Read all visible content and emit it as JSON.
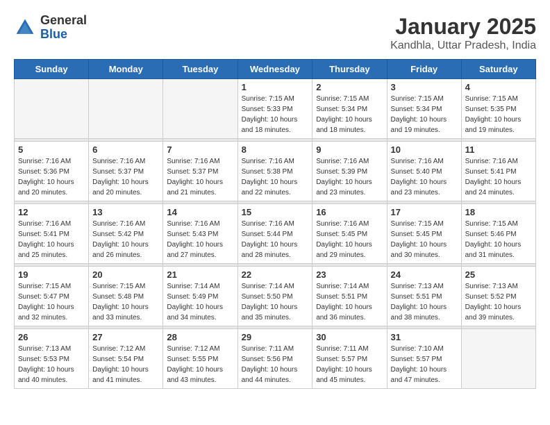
{
  "header": {
    "logo": {
      "brand1": "General",
      "brand2": "Blue"
    },
    "title": "January 2025",
    "subtitle": "Kandhla, Uttar Pradesh, India"
  },
  "weekdays": [
    "Sunday",
    "Monday",
    "Tuesday",
    "Wednesday",
    "Thursday",
    "Friday",
    "Saturday"
  ],
  "weeks": [
    [
      {
        "day": null,
        "sunrise": null,
        "sunset": null,
        "daylight": null
      },
      {
        "day": null,
        "sunrise": null,
        "sunset": null,
        "daylight": null
      },
      {
        "day": null,
        "sunrise": null,
        "sunset": null,
        "daylight": null
      },
      {
        "day": "1",
        "sunrise": "Sunrise: 7:15 AM",
        "sunset": "Sunset: 5:33 PM",
        "daylight": "Daylight: 10 hours and 18 minutes."
      },
      {
        "day": "2",
        "sunrise": "Sunrise: 7:15 AM",
        "sunset": "Sunset: 5:34 PM",
        "daylight": "Daylight: 10 hours and 18 minutes."
      },
      {
        "day": "3",
        "sunrise": "Sunrise: 7:15 AM",
        "sunset": "Sunset: 5:34 PM",
        "daylight": "Daylight: 10 hours and 19 minutes."
      },
      {
        "day": "4",
        "sunrise": "Sunrise: 7:15 AM",
        "sunset": "Sunset: 5:35 PM",
        "daylight": "Daylight: 10 hours and 19 minutes."
      }
    ],
    [
      {
        "day": "5",
        "sunrise": "Sunrise: 7:16 AM",
        "sunset": "Sunset: 5:36 PM",
        "daylight": "Daylight: 10 hours and 20 minutes."
      },
      {
        "day": "6",
        "sunrise": "Sunrise: 7:16 AM",
        "sunset": "Sunset: 5:37 PM",
        "daylight": "Daylight: 10 hours and 20 minutes."
      },
      {
        "day": "7",
        "sunrise": "Sunrise: 7:16 AM",
        "sunset": "Sunset: 5:37 PM",
        "daylight": "Daylight: 10 hours and 21 minutes."
      },
      {
        "day": "8",
        "sunrise": "Sunrise: 7:16 AM",
        "sunset": "Sunset: 5:38 PM",
        "daylight": "Daylight: 10 hours and 22 minutes."
      },
      {
        "day": "9",
        "sunrise": "Sunrise: 7:16 AM",
        "sunset": "Sunset: 5:39 PM",
        "daylight": "Daylight: 10 hours and 23 minutes."
      },
      {
        "day": "10",
        "sunrise": "Sunrise: 7:16 AM",
        "sunset": "Sunset: 5:40 PM",
        "daylight": "Daylight: 10 hours and 23 minutes."
      },
      {
        "day": "11",
        "sunrise": "Sunrise: 7:16 AM",
        "sunset": "Sunset: 5:41 PM",
        "daylight": "Daylight: 10 hours and 24 minutes."
      }
    ],
    [
      {
        "day": "12",
        "sunrise": "Sunrise: 7:16 AM",
        "sunset": "Sunset: 5:41 PM",
        "daylight": "Daylight: 10 hours and 25 minutes."
      },
      {
        "day": "13",
        "sunrise": "Sunrise: 7:16 AM",
        "sunset": "Sunset: 5:42 PM",
        "daylight": "Daylight: 10 hours and 26 minutes."
      },
      {
        "day": "14",
        "sunrise": "Sunrise: 7:16 AM",
        "sunset": "Sunset: 5:43 PM",
        "daylight": "Daylight: 10 hours and 27 minutes."
      },
      {
        "day": "15",
        "sunrise": "Sunrise: 7:16 AM",
        "sunset": "Sunset: 5:44 PM",
        "daylight": "Daylight: 10 hours and 28 minutes."
      },
      {
        "day": "16",
        "sunrise": "Sunrise: 7:16 AM",
        "sunset": "Sunset: 5:45 PM",
        "daylight": "Daylight: 10 hours and 29 minutes."
      },
      {
        "day": "17",
        "sunrise": "Sunrise: 7:15 AM",
        "sunset": "Sunset: 5:45 PM",
        "daylight": "Daylight: 10 hours and 30 minutes."
      },
      {
        "day": "18",
        "sunrise": "Sunrise: 7:15 AM",
        "sunset": "Sunset: 5:46 PM",
        "daylight": "Daylight: 10 hours and 31 minutes."
      }
    ],
    [
      {
        "day": "19",
        "sunrise": "Sunrise: 7:15 AM",
        "sunset": "Sunset: 5:47 PM",
        "daylight": "Daylight: 10 hours and 32 minutes."
      },
      {
        "day": "20",
        "sunrise": "Sunrise: 7:15 AM",
        "sunset": "Sunset: 5:48 PM",
        "daylight": "Daylight: 10 hours and 33 minutes."
      },
      {
        "day": "21",
        "sunrise": "Sunrise: 7:14 AM",
        "sunset": "Sunset: 5:49 PM",
        "daylight": "Daylight: 10 hours and 34 minutes."
      },
      {
        "day": "22",
        "sunrise": "Sunrise: 7:14 AM",
        "sunset": "Sunset: 5:50 PM",
        "daylight": "Daylight: 10 hours and 35 minutes."
      },
      {
        "day": "23",
        "sunrise": "Sunrise: 7:14 AM",
        "sunset": "Sunset: 5:51 PM",
        "daylight": "Daylight: 10 hours and 36 minutes."
      },
      {
        "day": "24",
        "sunrise": "Sunrise: 7:13 AM",
        "sunset": "Sunset: 5:51 PM",
        "daylight": "Daylight: 10 hours and 38 minutes."
      },
      {
        "day": "25",
        "sunrise": "Sunrise: 7:13 AM",
        "sunset": "Sunset: 5:52 PM",
        "daylight": "Daylight: 10 hours and 39 minutes."
      }
    ],
    [
      {
        "day": "26",
        "sunrise": "Sunrise: 7:13 AM",
        "sunset": "Sunset: 5:53 PM",
        "daylight": "Daylight: 10 hours and 40 minutes."
      },
      {
        "day": "27",
        "sunrise": "Sunrise: 7:12 AM",
        "sunset": "Sunset: 5:54 PM",
        "daylight": "Daylight: 10 hours and 41 minutes."
      },
      {
        "day": "28",
        "sunrise": "Sunrise: 7:12 AM",
        "sunset": "Sunset: 5:55 PM",
        "daylight": "Daylight: 10 hours and 43 minutes."
      },
      {
        "day": "29",
        "sunrise": "Sunrise: 7:11 AM",
        "sunset": "Sunset: 5:56 PM",
        "daylight": "Daylight: 10 hours and 44 minutes."
      },
      {
        "day": "30",
        "sunrise": "Sunrise: 7:11 AM",
        "sunset": "Sunset: 5:57 PM",
        "daylight": "Daylight: 10 hours and 45 minutes."
      },
      {
        "day": "31",
        "sunrise": "Sunrise: 7:10 AM",
        "sunset": "Sunset: 5:57 PM",
        "daylight": "Daylight: 10 hours and 47 minutes."
      },
      {
        "day": null,
        "sunrise": null,
        "sunset": null,
        "daylight": null
      }
    ]
  ]
}
